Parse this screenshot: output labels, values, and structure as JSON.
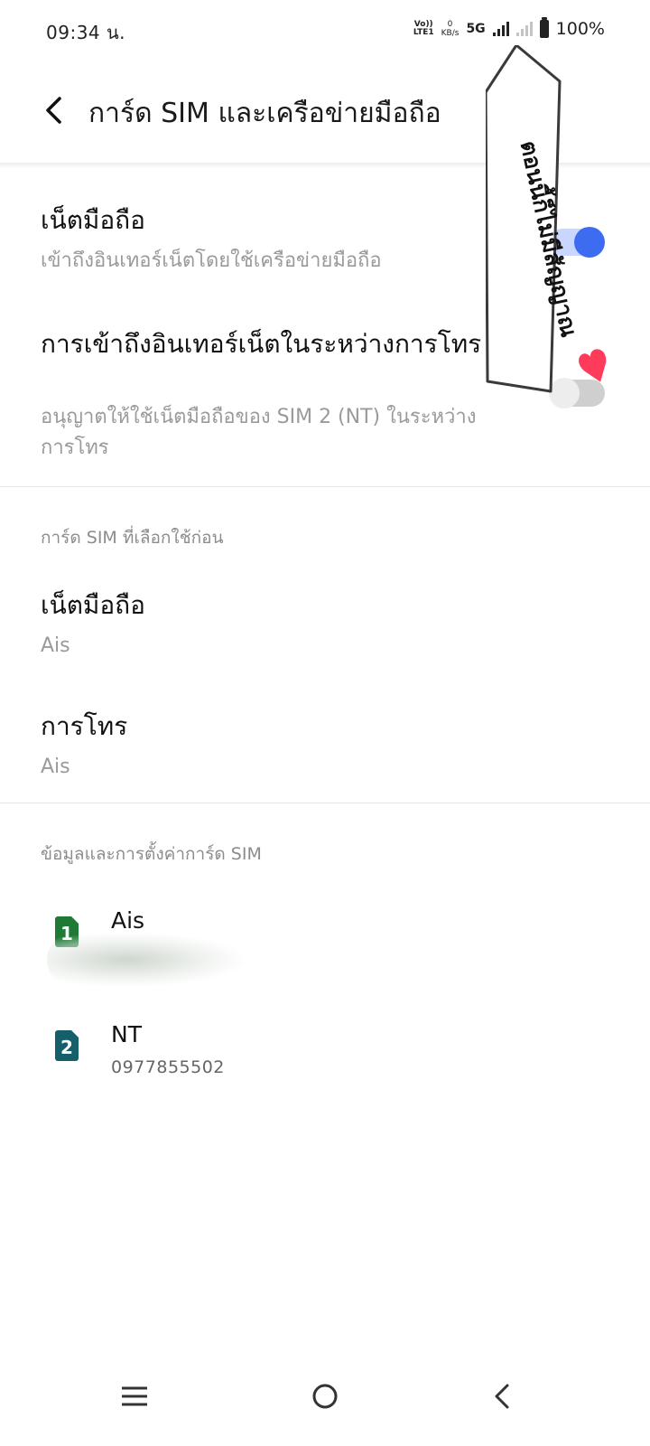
{
  "status_bar": {
    "time": "09:34 น.",
    "volte_line1": "Vo))",
    "volte_line2": "LTE1",
    "speed_value": "0",
    "speed_unit": "KB/s",
    "network": "5G",
    "battery": "100%",
    "icons": [
      "volte-icon",
      "signal-icon",
      "signal-weak-icon",
      "battery-icon"
    ]
  },
  "header": {
    "back_icon": "back-arrow-icon",
    "title": "การ์ด SIM และเครือข่ายมือถือ"
  },
  "settings": {
    "mobile_data": {
      "title": "เน็ตมือถือ",
      "subtitle": "เข้าถึงอินเทอร์เน็ตโดยใช้เครือข่ายมือถือ",
      "enabled": true
    },
    "data_during_calls": {
      "title": "การเข้าถึงอินเทอร์เน็ตในระหว่างการโทร",
      "subtitle": "อนุญาตให้ใช้เน็ตมือถือของ SIM 2 (NT) ในระหว่างการโทร",
      "enabled": false
    }
  },
  "preferred_sim": {
    "section_label": "การ์ด SIM ที่เลือกใช้ก่อน",
    "items": [
      {
        "title": "เน็ตมือถือ",
        "value": "Ais"
      },
      {
        "title": "การโทร",
        "value": "Ais"
      }
    ]
  },
  "sim_info": {
    "section_label": "ข้อมูลและการตั้งค่าการ์ด SIM",
    "cards": [
      {
        "slot": "1",
        "name": "Ais",
        "number": ""
      },
      {
        "slot": "2",
        "name": "NT",
        "number": "0977855502"
      }
    ]
  },
  "sticker": {
    "text": "ตอนนี้ก็ไม่มีสัญญาณ"
  },
  "colors": {
    "accent": "#3e6cf0",
    "sim1": "#1f7a36",
    "sim2": "#145f6a",
    "heart": "#ff3b5c"
  },
  "navbar": {
    "icons": [
      "menu-icon",
      "home-icon",
      "back-icon"
    ]
  }
}
